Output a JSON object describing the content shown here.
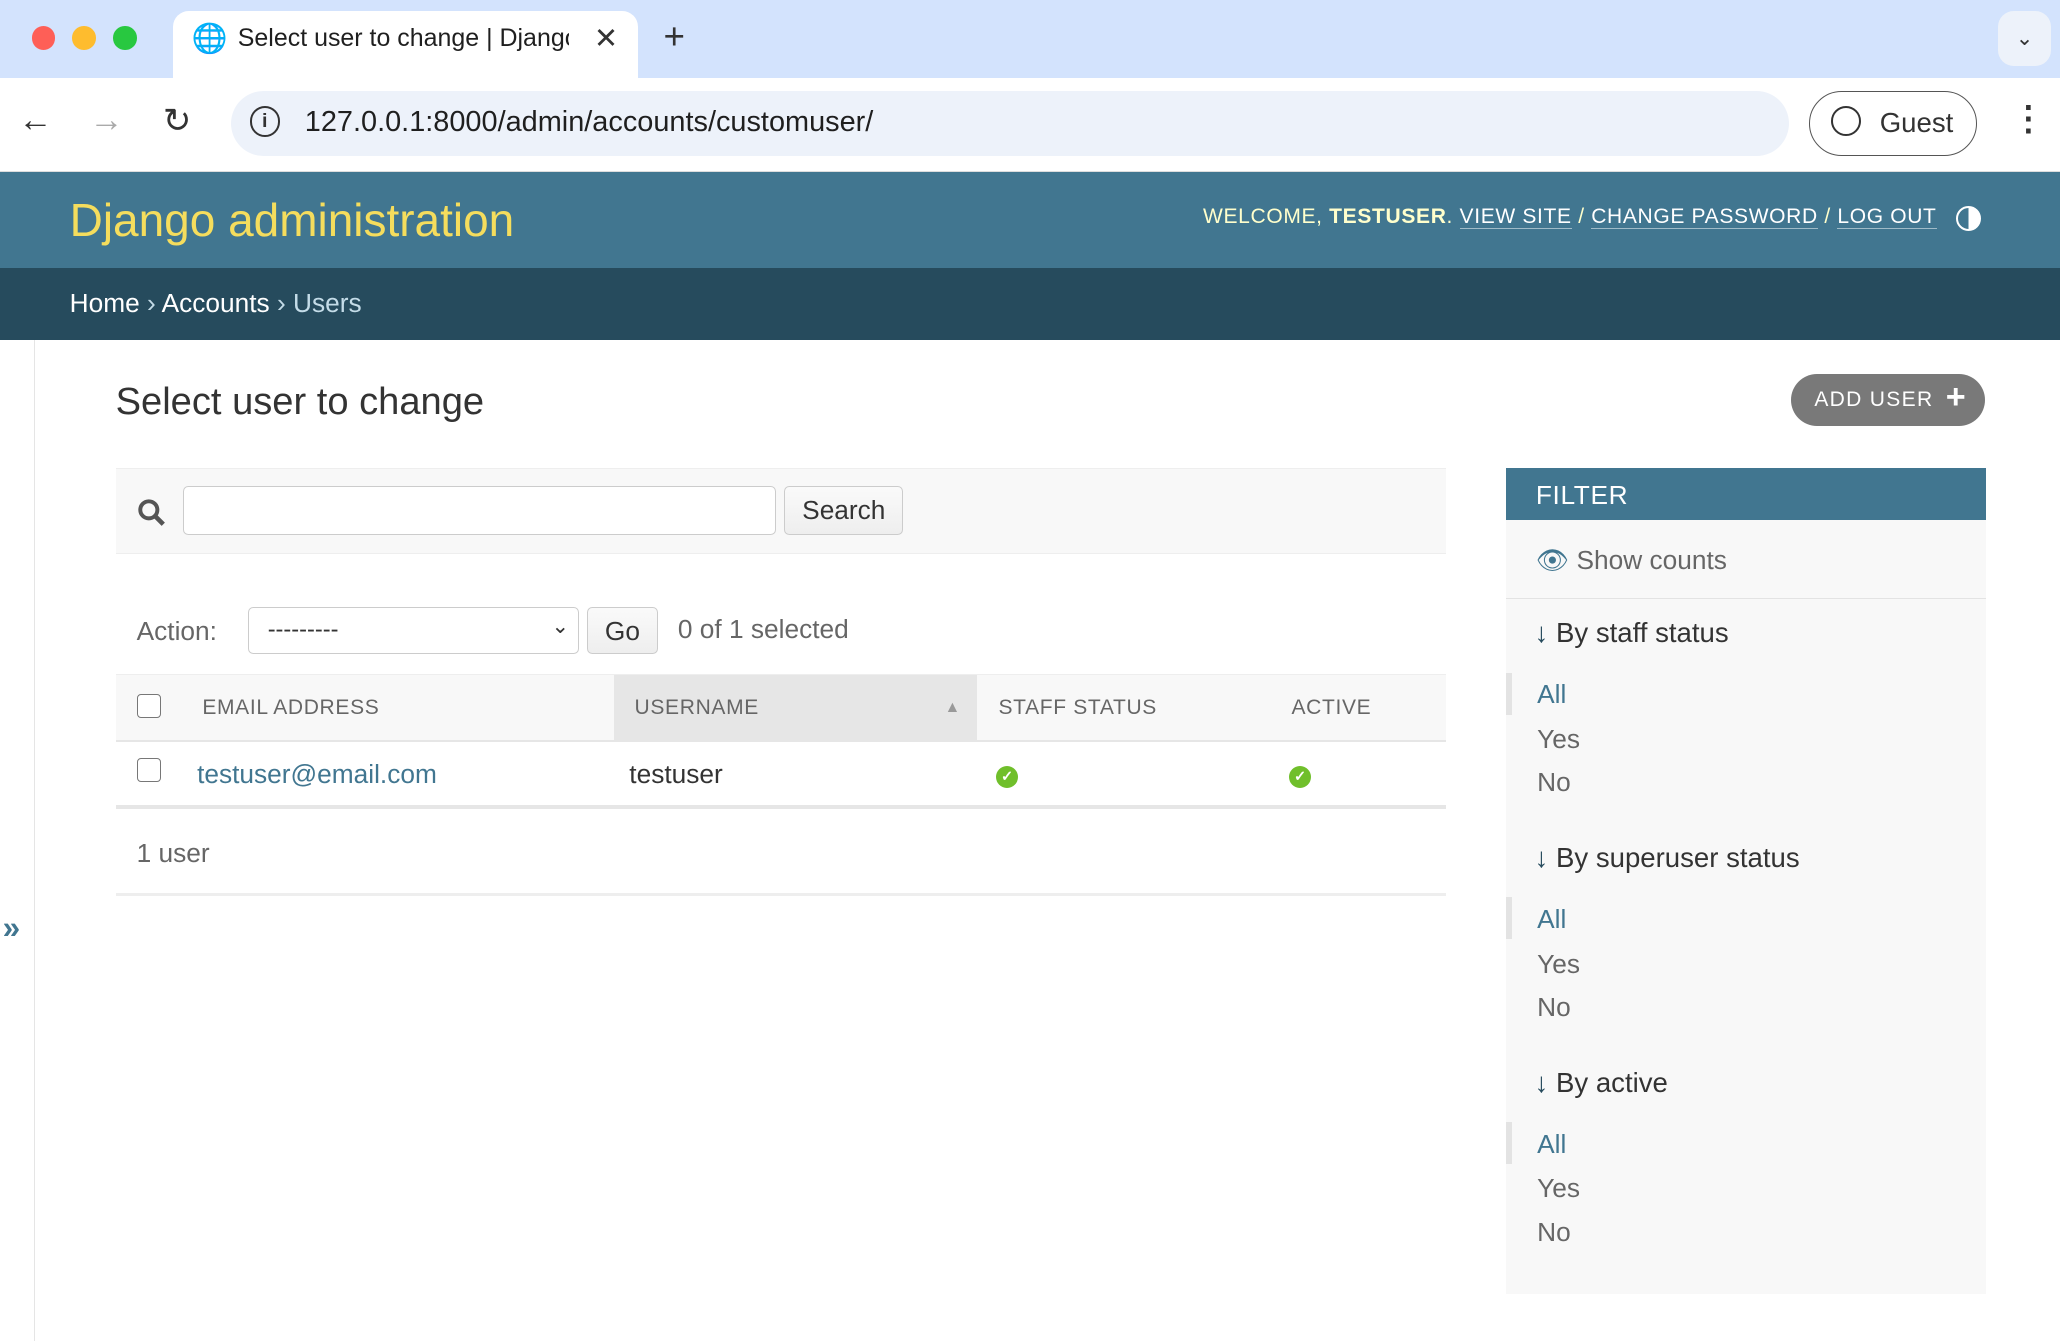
{
  "browser": {
    "tab_title": "Select user to change | Django site admin",
    "url": "127.0.0.1:8000/admin/accounts/customuser/",
    "profile": "Guest"
  },
  "header": {
    "brand": "Django administration",
    "welcome": "WELCOME, ",
    "username": "TESTUSER",
    "view_site": "VIEW SITE",
    "change_password": "CHANGE PASSWORD",
    "log_out": "LOG OUT",
    "sep": " / "
  },
  "breadcrumbs": {
    "home": "Home",
    "accounts": "Accounts",
    "users": "Users",
    "sep": " › "
  },
  "page": {
    "title": "Select user to change",
    "add_button": "ADD USER"
  },
  "search": {
    "value": "",
    "button": "Search"
  },
  "actions": {
    "label": "Action:",
    "selected_option": "---------",
    "go": "Go",
    "counter": "0 of 1 selected"
  },
  "table": {
    "columns": [
      "EMAIL ADDRESS",
      "USERNAME",
      "STAFF STATUS",
      "ACTIVE"
    ],
    "rows": [
      {
        "email": "testuser@email.com",
        "username": "testuser",
        "staff": true,
        "active": true
      }
    ],
    "paginator": "1 user"
  },
  "filter": {
    "title": "FILTER",
    "show_counts": "Show counts",
    "groups": [
      {
        "title": "By staff status",
        "options": [
          "All",
          "Yes",
          "No"
        ]
      },
      {
        "title": "By superuser status",
        "options": [
          "All",
          "Yes",
          "No"
        ]
      },
      {
        "title": "By active",
        "options": [
          "All",
          "Yes",
          "No"
        ]
      }
    ]
  },
  "sidebar_toggle": "»"
}
